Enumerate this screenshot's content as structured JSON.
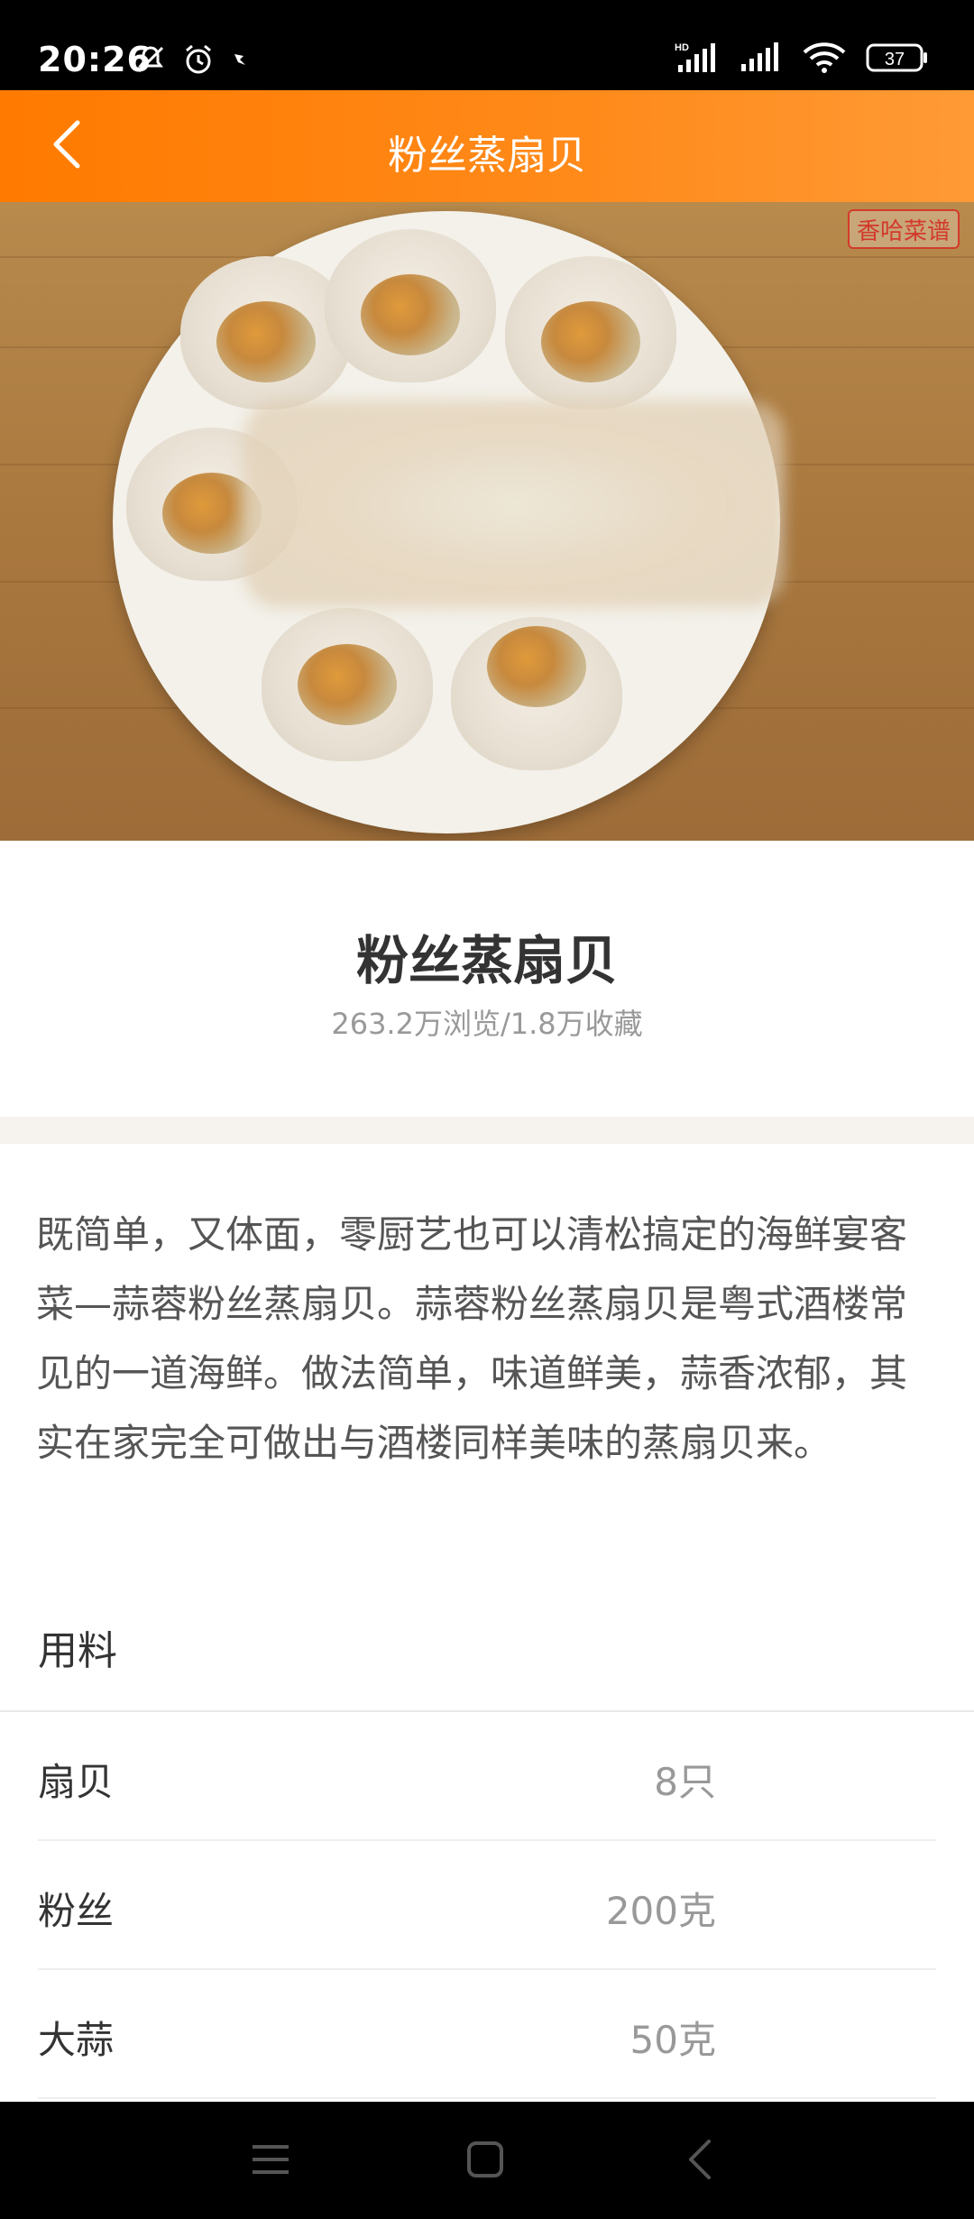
{
  "status_bar": {
    "time": "20:26",
    "battery": "37",
    "icons": [
      "mute-icon",
      "alarm-icon",
      "app-notification-icon",
      "hd-signal-icon",
      "signal-icon",
      "wifi-icon",
      "battery-icon"
    ]
  },
  "app_bar": {
    "title": "粉丝蒸扇贝",
    "back_icon": "chevron-left-icon",
    "color": "#ff7a00"
  },
  "hero": {
    "watermark": "香哈菜谱"
  },
  "recipe": {
    "title": "粉丝蒸扇贝",
    "stats": "263.2万浏览/1.8万收藏",
    "description": "既简单，又体面，零厨艺也可以清松搞定的海鲜宴客菜—蒜蓉粉丝蒸扇贝。蒜蓉粉丝蒸扇贝是粤式酒楼常见的一道海鲜。做法简单，味道鲜美，蒜香浓郁，其实在家完全可做出与酒楼同样美味的蒸扇贝来。"
  },
  "ingredients": {
    "heading": "用料",
    "items": [
      {
        "name": "扇贝",
        "amount": "8只"
      },
      {
        "name": "粉丝",
        "amount": "200克"
      },
      {
        "name": "大蒜",
        "amount": "50克"
      }
    ]
  },
  "nav_bar": {
    "icons": [
      "menu-icon",
      "home-icon",
      "back-icon"
    ]
  }
}
